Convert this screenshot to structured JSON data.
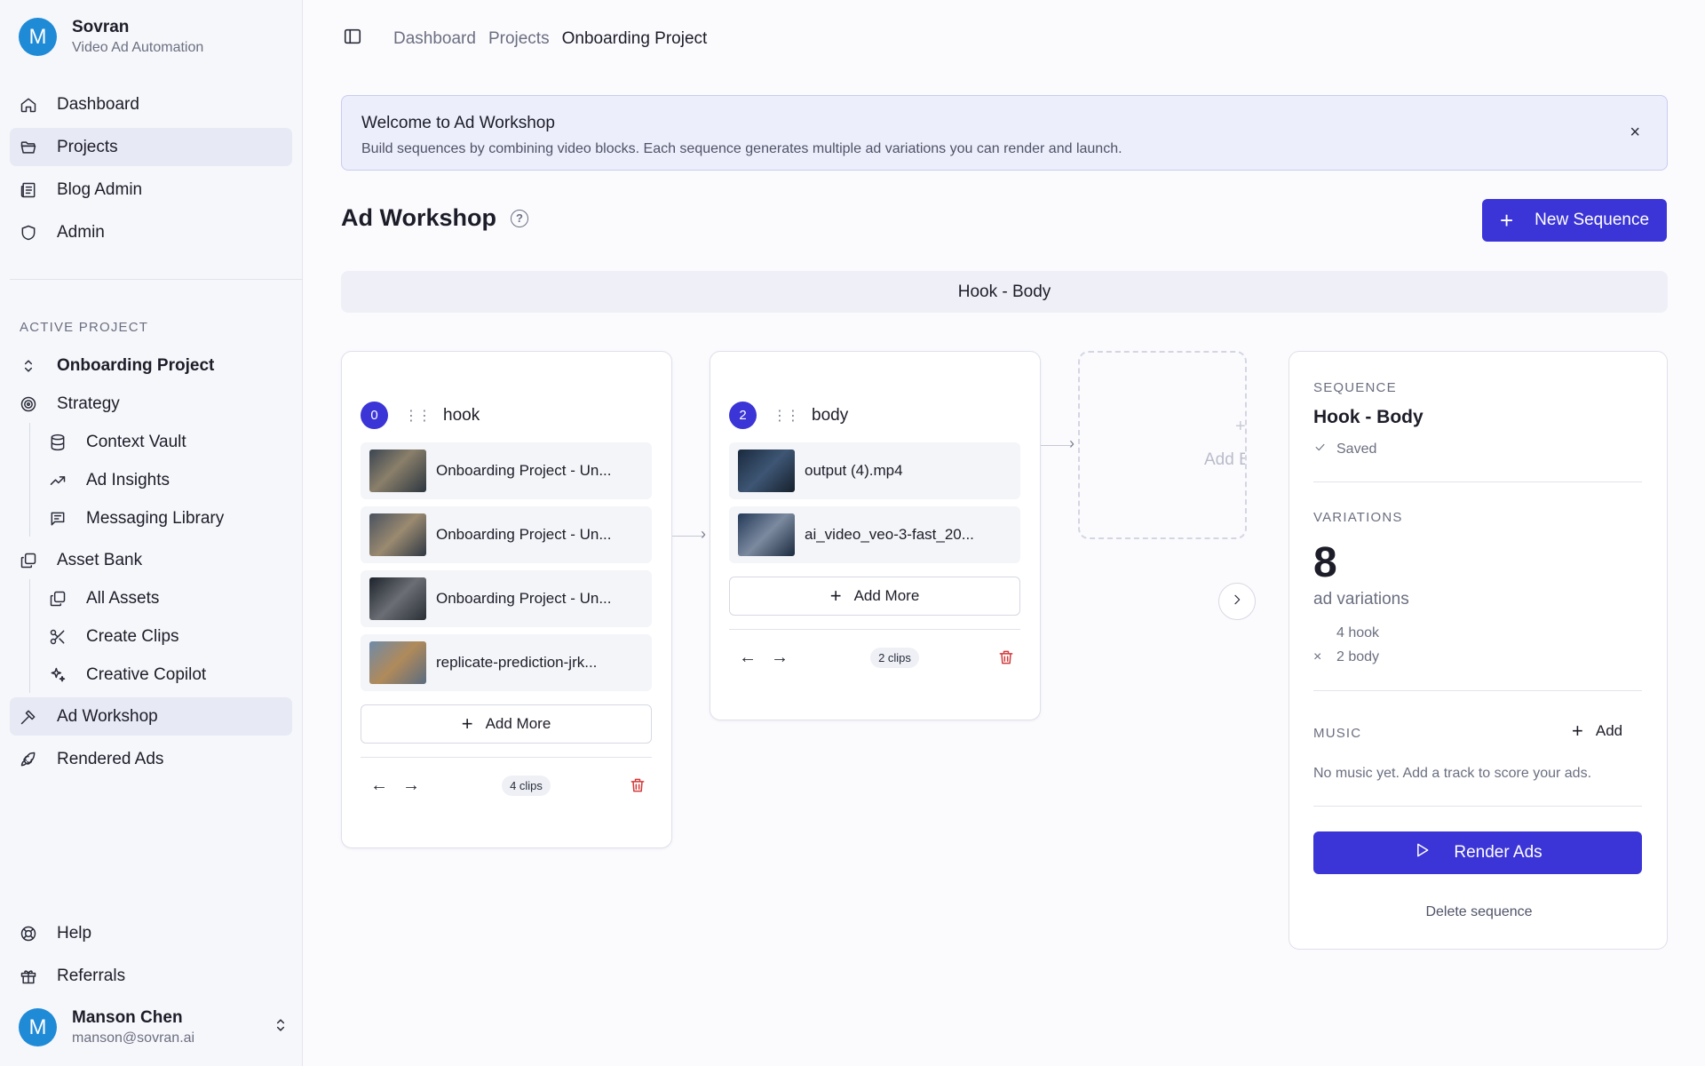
{
  "brand": {
    "initial": "M",
    "name": "Sovran",
    "subtitle": "Video Ad Automation"
  },
  "nav": {
    "dashboard": "Dashboard",
    "projects": "Projects",
    "blog_admin": "Blog Admin",
    "admin": "Admin"
  },
  "active_project": {
    "section_label": "ACTIVE PROJECT",
    "name": "Onboarding Project",
    "strategy": "Strategy",
    "context_vault": "Context Vault",
    "ad_insights": "Ad Insights",
    "messaging_library": "Messaging Library",
    "asset_bank": "Asset Bank",
    "all_assets": "All Assets",
    "create_clips": "Create Clips",
    "creative_copilot": "Creative Copilot",
    "ad_workshop": "Ad Workshop",
    "rendered_ads": "Rendered Ads"
  },
  "footer_nav": {
    "help": "Help",
    "referrals": "Referrals"
  },
  "user": {
    "initial": "M",
    "name": "Manson Chen",
    "email": "manson@sovran.ai"
  },
  "breadcrumb": [
    "Dashboard",
    "Projects",
    "Onboarding Project"
  ],
  "banner": {
    "title": "Welcome to Ad Workshop",
    "text": "Build sequences by combining video blocks. Each sequence generates multiple ad variations you can render and launch.",
    "close": "×"
  },
  "workshop": {
    "title": "Ad Workshop",
    "help": "?",
    "new_sequence": "New Sequence",
    "plus": "+"
  },
  "sequence_tab": "Hook - Body",
  "blocks": [
    {
      "index": "0",
      "name": "hook",
      "clips": [
        "Onboarding Project - Un...",
        "Onboarding Project - Un...",
        "Onboarding Project - Un...",
        "replicate-prediction-jrk..."
      ],
      "add_more": "Add More",
      "count": "4 clips"
    },
    {
      "index": "2",
      "name": "body",
      "clips": [
        "output (4).mp4",
        "ai_video_veo-3-fast_20..."
      ],
      "add_more": "Add More",
      "count": "2 clips"
    }
  ],
  "add_block": {
    "label": "Add Bl",
    "plus": "+"
  },
  "panel": {
    "sequence_label": "SEQUENCE",
    "sequence_name": "Hook - Body",
    "saved": "Saved",
    "variations_label": "VARIATIONS",
    "variations_count": "8",
    "variations_sub": "ad variations",
    "breakdown": [
      {
        "prefix": "",
        "text": "4 hook"
      },
      {
        "prefix": "×",
        "text": "2 body"
      }
    ],
    "music_label": "MUSIC",
    "music_add": "Add",
    "music_empty": "No music yet. Add a track to score your ads.",
    "render": "Render Ads",
    "delete": "Delete sequence"
  },
  "colors": {
    "accent": "#3b34d6",
    "avatar": "#1f8ad6",
    "danger": "#d23a3a"
  }
}
